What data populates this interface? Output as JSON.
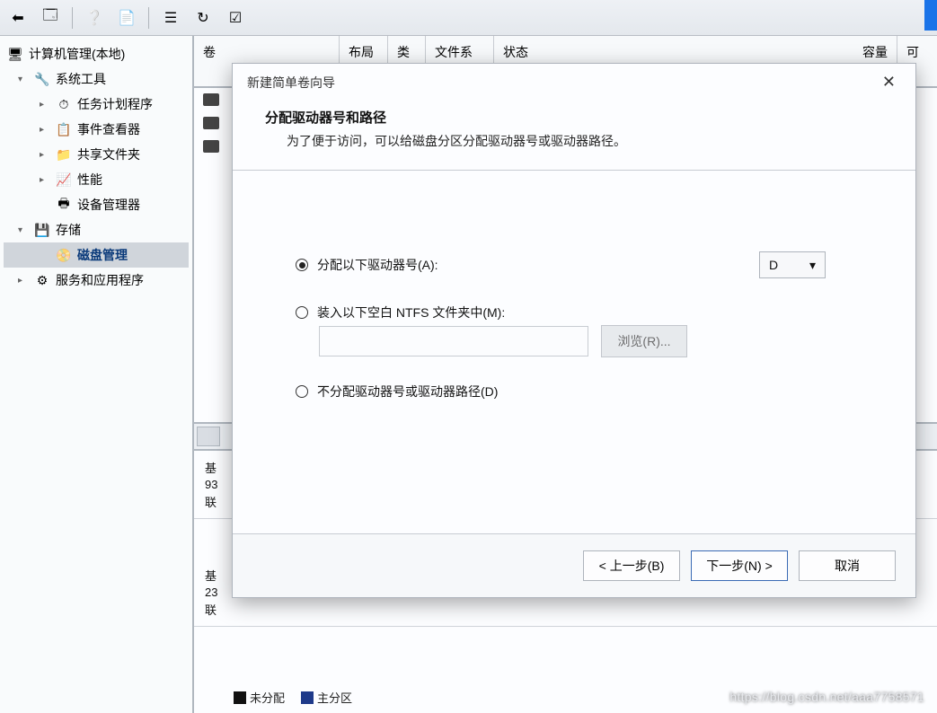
{
  "toolbar_icons": [
    "back-arrow-icon",
    "app-icon",
    "help-icon",
    "folder-icon",
    "list-icon",
    "refresh-icon",
    "checkbox-icon"
  ],
  "sidebar": {
    "root": "计算机管理(本地)",
    "items": [
      {
        "label": "系统工具",
        "level": 1,
        "expand": "▾",
        "icon": "🔧"
      },
      {
        "label": "任务计划程序",
        "level": 2,
        "expand": "▸",
        "icon": "⏱"
      },
      {
        "label": "事件查看器",
        "level": 2,
        "expand": "▸",
        "icon": "📋"
      },
      {
        "label": "共享文件夹",
        "level": 2,
        "expand": "▸",
        "icon": "📁"
      },
      {
        "label": "性能",
        "level": 2,
        "expand": "▸",
        "icon": "📈"
      },
      {
        "label": "设备管理器",
        "level": 2,
        "expand": "",
        "icon": "🖶"
      },
      {
        "label": "存储",
        "level": 1,
        "expand": "▾",
        "icon": "💾",
        "selected": false
      },
      {
        "label": "磁盘管理",
        "level": 2,
        "expand": "",
        "icon": "📀",
        "selected": true
      },
      {
        "label": "服务和应用程序",
        "level": 1,
        "expand": "▸",
        "icon": "⚙"
      }
    ]
  },
  "table": {
    "headers": {
      "volume": "卷",
      "layout": "布局",
      "type": "类型",
      "fs": "文件系统",
      "state": "状态",
      "capacity": "容量",
      "available": "可"
    }
  },
  "disk_rows": [
    {
      "type_label": "基",
      "size": "93",
      "status": "联"
    },
    {
      "type_label": "基",
      "size": "23",
      "status": "联"
    }
  ],
  "legend": {
    "unallocated": "未分配",
    "primary": "主分区"
  },
  "dialog": {
    "title": "新建简单卷向导",
    "heading": "分配驱动器号和路径",
    "subheading": "为了便于访问，可以给磁盘分区分配驱动器号或驱动器路径。",
    "opt_assign": "分配以下驱动器号(A):",
    "opt_mount": "装入以下空白 NTFS 文件夹中(M):",
    "opt_none": "不分配驱动器号或驱动器路径(D)",
    "drive_letter": "D",
    "browse": "浏览(R)...",
    "btn_back": "< 上一步(B)",
    "btn_next": "下一步(N) >",
    "btn_cancel": "取消"
  },
  "watermark": "https://blog.csdn.net/aaa7758571"
}
